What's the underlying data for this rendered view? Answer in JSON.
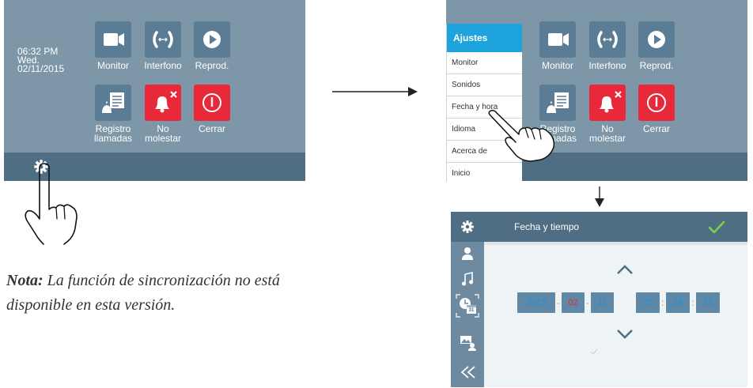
{
  "screen1": {
    "time": "06:32 PM",
    "day": "Wed.",
    "date": "02/11/2015",
    "tiles": {
      "monitor": "Monitor",
      "intercom": "Interfono",
      "playback": "Reprod.",
      "call_log_1": "Registro",
      "call_log_2": "llamadas",
      "dnd_1": "No",
      "dnd_2": "molestar",
      "close": "Cerrar"
    }
  },
  "screen2": {
    "tiles": {
      "monitor": "Monitor",
      "intercom": "Interfono",
      "playback": "Reprod.",
      "call_log_1": "Registro",
      "call_log_2": "llamadas",
      "dnd_1": "No",
      "dnd_2": "molestar",
      "close": "Cerrar"
    },
    "menu": {
      "header": "Ajustes",
      "items": [
        "Monitor",
        "Sonidos",
        "Fecha y hora",
        "Idioma",
        "Acerca de",
        "Inicio"
      ]
    }
  },
  "screen3": {
    "title": "Fecha y tiempo",
    "year": "2015",
    "month": "02",
    "day": "11",
    "hour": "15",
    "minute": "28",
    "second": "10",
    "date_sep": "-",
    "time_sep": ":",
    "calendar_badge": "31"
  },
  "note": {
    "label": "Nota:",
    "text": "La función de sincronización no está disponible en esta versión."
  },
  "colors": {
    "screen_bg": "#7d97a8",
    "bar": "#4f6e84",
    "tile": "#5a7c95",
    "tile_alert": "#e8293a",
    "menu_header": "#1fa3dc",
    "check": "#7ad14a"
  }
}
